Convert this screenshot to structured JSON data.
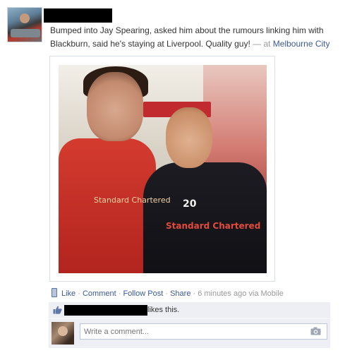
{
  "post": {
    "text_main": "Bumped into Jay Spearing, asked him about the rumours linking him with Blackburn, said he's staying at Liverpool. Quality guy!",
    "location_sep": " — at ",
    "location": "Melbourne City"
  },
  "photo": {
    "jersey_sponsor_left": "Standard Chartered",
    "jersey_sponsor_right": "Standard Chartered",
    "jersey_number": "20"
  },
  "actions": {
    "like": "Like",
    "comment": "Comment",
    "follow": "Follow Post",
    "share": "Share",
    "separator": " · ",
    "timestamp": "6 minutes ago",
    "via": "via Mobile"
  },
  "likes": {
    "text": "likes this."
  },
  "comment": {
    "placeholder": "Write a comment..."
  },
  "icons": {
    "mobile": "mobile-icon",
    "thumb": "thumbs-up-icon",
    "camera": "camera-icon"
  },
  "colors": {
    "link": "#3b5998",
    "meta": "#999999",
    "panel": "#edeff4"
  }
}
